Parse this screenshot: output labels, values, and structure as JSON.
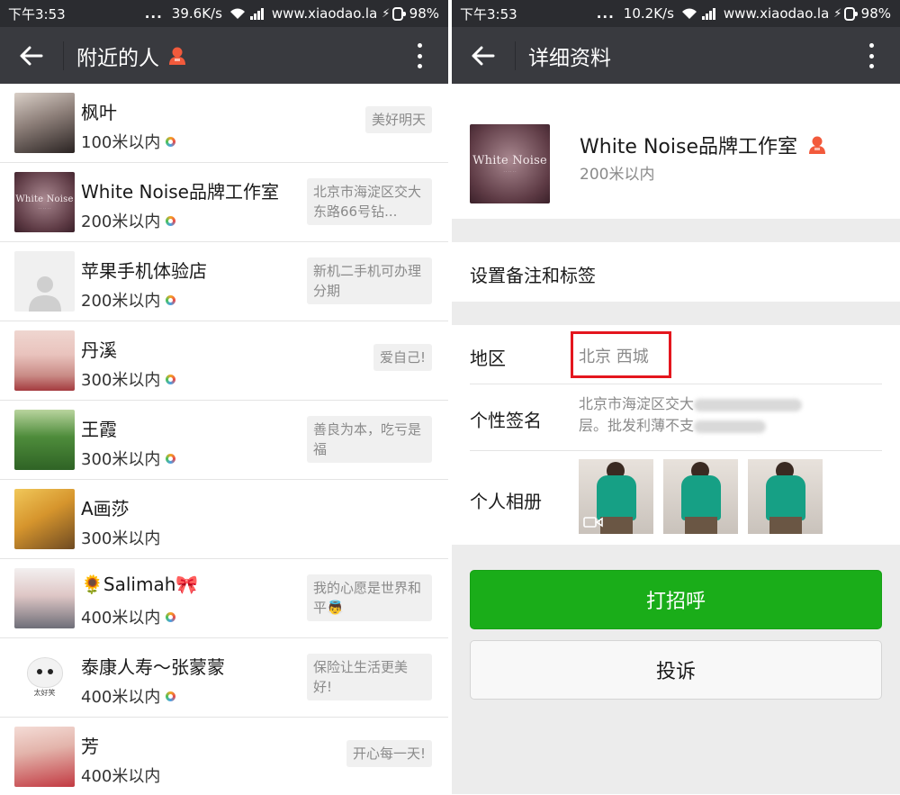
{
  "left": {
    "status": {
      "time": "下午3:53",
      "dots": "...",
      "speed": "39.6K/s",
      "site": "www.xiaodao.la",
      "battery": "98%",
      "battery_level": 0.98
    },
    "header": {
      "title": "附近的人"
    },
    "people": [
      {
        "name": "枫叶",
        "distance": "100米以内",
        "signature": "美好明天"
      },
      {
        "name": "White Noise品牌工作室",
        "distance": "200米以内",
        "signature": "北京市海淀区交大东路66号钻..."
      },
      {
        "name": "苹果手机体验店",
        "distance": "200米以内",
        "signature": "新机二手机可办理分期"
      },
      {
        "name": "丹溪",
        "distance": "300米以内",
        "signature": "爱自己!"
      },
      {
        "name": "王霞",
        "distance": "300米以内",
        "signature": "善良为本，吃亏是福"
      },
      {
        "name": "A画莎",
        "distance": "300米以内",
        "signature": ""
      },
      {
        "name": "🌻Salimah🎀",
        "distance": "400米以内",
        "signature": "我的心愿是世界和平👼"
      },
      {
        "name": "泰康人寿～张蒙蒙",
        "distance": "400米以内",
        "signature": "保险让生活更美好!"
      },
      {
        "name": "芳",
        "distance": "400米以内",
        "signature": "开心每一天!"
      }
    ],
    "avatar_text": {
      "white_noise": "White Noise",
      "dog_caption": "太好笑"
    }
  },
  "right": {
    "status": {
      "time": "下午3:53",
      "dots": "...",
      "speed": "10.2K/s",
      "site": "www.xiaodao.la",
      "battery": "98%",
      "battery_level": 0.98
    },
    "header": {
      "title": "详细资料"
    },
    "profile": {
      "name": "White Noise品牌工作室",
      "distance": "200米以内",
      "avatar_text": "White Noise"
    },
    "remark_label": "设置备注和标签",
    "region": {
      "label": "地区",
      "value": "北京  西城"
    },
    "signature": {
      "label": "个性签名",
      "line1": "北京市海淀区交大",
      "line2": "层。批发利薄不支"
    },
    "album": {
      "label": "个人相册"
    },
    "greet_button": "打招呼",
    "report_button": "投诉"
  },
  "colors": {
    "title_bar": "#393a3f",
    "status_bar": "#2b2c30",
    "greet_green": "#1aad19",
    "highlight_red": "#e4161e",
    "person_icon": "#f25a3c"
  }
}
